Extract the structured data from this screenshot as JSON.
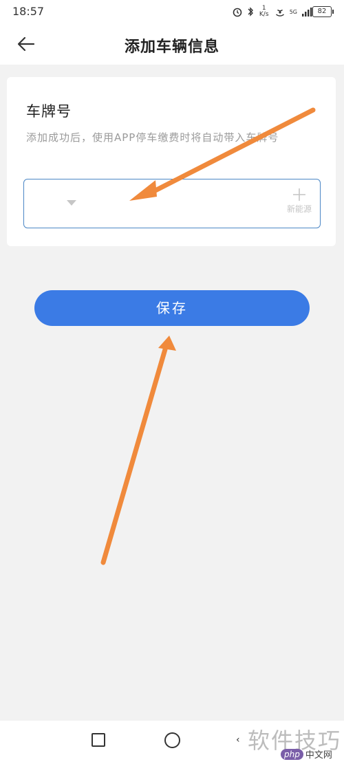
{
  "status_bar": {
    "time": "18:57",
    "network_speed": "1 K/s",
    "signal_label": "5G",
    "battery": "82",
    "icons": [
      "alarm-icon",
      "bluetooth-icon",
      "hotspot-icon",
      "signal-icon",
      "battery-icon"
    ]
  },
  "header": {
    "title": "添加车辆信息",
    "back_icon": "arrow-left-icon"
  },
  "card": {
    "label": "车牌号",
    "description": "添加成功后，使用APP停车缴费时将自动带入车牌号",
    "plate_input": {
      "value": "",
      "new_energy_label": "新能源"
    }
  },
  "save_button": {
    "label": "保存"
  },
  "nav_bar": {
    "back_glyph": "‹",
    "items": [
      "recent-apps-icon",
      "home-icon",
      "back-icon"
    ]
  },
  "watermark": {
    "text": "软件技巧",
    "logo": "php",
    "logo_cn": "中文网"
  },
  "colors": {
    "accent": "#3b7be5",
    "annotation_arrow": "#f08a3c",
    "input_border": "#4a86c5"
  }
}
